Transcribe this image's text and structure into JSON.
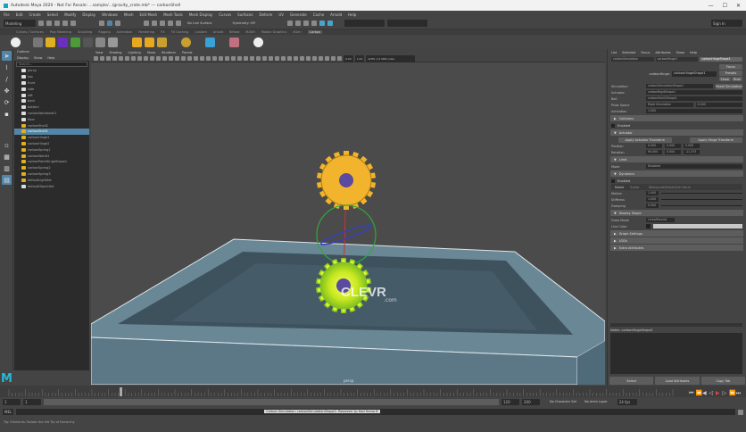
{
  "title": "Autodesk Maya 2020 - Not For Resale: ...sample/.../gravity_crate.mb* --- carbonShell",
  "window_controls": [
    "—",
    "☐",
    "✕"
  ],
  "menus": [
    "File",
    "Edit",
    "Create",
    "Select",
    "Modify",
    "Display",
    "Windows",
    "Mesh",
    "Edit Mesh",
    "Mesh Tools",
    "Mesh Display",
    "Curves",
    "Surfaces",
    "Deform",
    "UV",
    "Generate",
    "Cache",
    "Arnold",
    "Help"
  ],
  "status": {
    "mode": "Modeling",
    "symmetry": "Symmetry: Off",
    "live": "No Live Surface",
    "sign_in": "Sign In"
  },
  "shelf_tabs": [
    "Curves / Surfaces",
    "Poly Modeling",
    "Sculpting",
    "Rigging",
    "Animation",
    "Rendering",
    "FX",
    "FX Caching",
    "Custom",
    "Arnold",
    "Bifrost",
    "MASH",
    "Motion Graphics",
    "XGen",
    "Carbon"
  ],
  "shelf_active": "Carbon",
  "outliner": {
    "title": "Outliner",
    "menu": [
      "Display",
      "Show",
      "Help"
    ],
    "search_placeholder": "Search...",
    "items": [
      "persp",
      "top",
      "front",
      "side",
      "left",
      "back",
      "bottom",
      "carbonWorldshell1",
      "floor",
      "carbonShell2",
      "carbonShell1",
      "carbonHinge1",
      "carbonHinge2",
      "carbonSpring1",
      "carbonWorld1",
      "carbonPointHingeShape1",
      "carbonSpring2",
      "carbonSpring3",
      "defaultLightSet",
      "defaultObjectSet"
    ],
    "selected_index": 10
  },
  "viewport": {
    "menus": [
      "View",
      "Shading",
      "Lighting",
      "Show",
      "Renderer",
      "Panels"
    ],
    "camera_field": "ACES 1.0 SDR-video",
    "field1": "0.00",
    "field2": "1.00",
    "camera_label": "persp",
    "watermark": "CLEVR",
    "watermark_sub": ".com"
  },
  "attribute_editor": {
    "menus": [
      "List",
      "Selected",
      "Focus",
      "Attributes",
      "Show",
      "Help"
    ],
    "tabs": [
      "carbonSimulation",
      "carbonHinge1",
      "carbonHingeShape1"
    ],
    "node_label": "carbonHinge:",
    "node_value": "carbonHingeShape1",
    "buttons": {
      "focus": "Focus",
      "presets": "Presets",
      "show": "Show",
      "hide": "Hide"
    },
    "fields": [
      {
        "label": "Simulation",
        "value": "carbonSimulationShape1",
        "button": "Reset Simulation"
      },
      {
        "label": "Actuator",
        "value": "carbonRigidShape1"
      },
      {
        "label": "Ball",
        "value": "carbonShell2Shape1"
      },
      {
        "label": "Pivot Space",
        "value": "Rigid Simulation",
        "extra": "0.000"
      },
      {
        "label": "Activation",
        "value": "1.000"
      }
    ],
    "sections": [
      "Collisions",
      "Actuator",
      "Pivot Simulation",
      "Limit",
      "Dynamics",
      "Display Shape",
      "Graph Settings",
      "LODs",
      "Extra Attributes"
    ],
    "enable_label": "Enabled",
    "apply_buttons": [
      "Apply Actuator Transform",
      "Apply Hinge Transform"
    ],
    "position": {
      "label": "Position",
      "values": [
        "0.000",
        "0.000",
        "0.000"
      ]
    },
    "rotation": {
      "label": "Rotation",
      "values": [
        "90.000",
        "0.000",
        "-11.373"
      ]
    },
    "limit_mode": {
      "label": "Mode",
      "value": "Disabled"
    },
    "dyn_cols": [
      "Name",
      "Scalar",
      "Measured/Set/Active Value"
    ],
    "dyn_rows": [
      {
        "label": "Motion",
        "value": "1.000"
      },
      {
        "label": "Stiffness",
        "value": "1.000"
      },
      {
        "label": "Damping",
        "value": "0.000"
      }
    ],
    "draw_mode": {
      "label": "Draw Mode",
      "value": "Lines/Bounds"
    },
    "color_label": "Line Color",
    "notes_label": "Notes: carbonHingeShape1",
    "bottom_buttons": [
      "Select",
      "Load Attributes",
      "Copy Tab"
    ]
  },
  "timeline": {
    "start": "1",
    "current": "1",
    "range_start": "1",
    "range_end": "120",
    "end": "120",
    "end2": "200",
    "fps": "24 fps",
    "char_set": "No Character Set",
    "anim_layer": "No Anim Layer"
  },
  "command": {
    "lang": "MEL",
    "result": "Carbon Simulation: carbonSimulationShape1: Resolved 1p Had Hema ft"
  },
  "help_line": "Tip: Elements: Rotate the left Tip of hierarchy",
  "colors": {
    "accent": "#5285a6",
    "gear": "#f2b42c",
    "tray": "#5d7787"
  }
}
